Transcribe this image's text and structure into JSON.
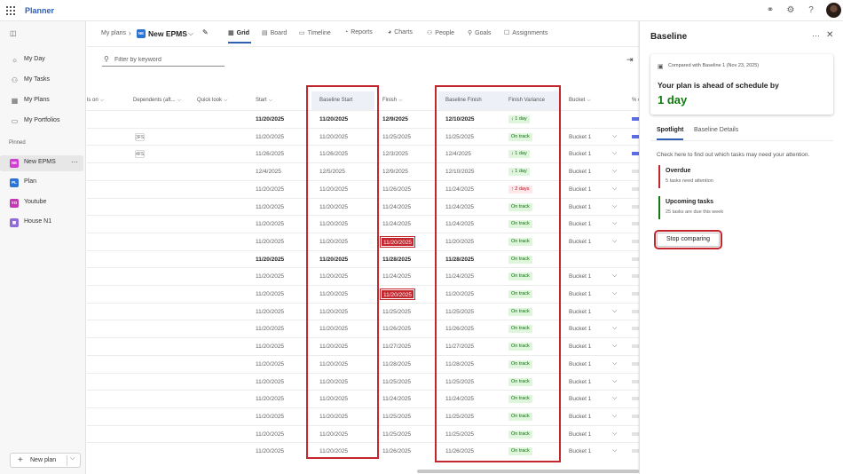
{
  "app": {
    "title": "Planner"
  },
  "topbar": {
    "icons": [
      "waffle-icon",
      "share-icon",
      "settings-icon",
      "help-icon",
      "avatar"
    ]
  },
  "leftnav": {
    "items": [
      {
        "label": "My Day",
        "icon": "sun-icon"
      },
      {
        "label": "My Tasks",
        "icon": "person-icon"
      },
      {
        "label": "My Plans",
        "icon": "grid-icon"
      },
      {
        "label": "My Portfolios",
        "icon": "folder-icon"
      }
    ],
    "pinned_label": "Pinned",
    "pinned": [
      {
        "label": "New EPMS",
        "badge": "NE",
        "color": "#d13dd1"
      },
      {
        "label": "Plan",
        "badge": "PL",
        "color": "#2b73d6"
      },
      {
        "label": "Youtube",
        "badge": "YO",
        "color": "#c239b3"
      },
      {
        "label": "House N1",
        "badge": "▦",
        "color": "#8e6bd6"
      }
    ],
    "new_plan": "New plan"
  },
  "header": {
    "breadcrumb_root": "My plans",
    "plan_badge": "NE",
    "plan_name": "New EPMS",
    "tabs": [
      {
        "label": "Grid",
        "icon": "▦"
      },
      {
        "label": "Board",
        "icon": "▤"
      },
      {
        "label": "Timeline",
        "icon": "▭"
      },
      {
        "label": "Reports",
        "icon": "◔"
      },
      {
        "label": "Charts",
        "icon": "◕"
      },
      {
        "label": "People",
        "icon": "⚇"
      },
      {
        "label": "Goals",
        "icon": "⚲"
      },
      {
        "label": "Assignments",
        "icon": "☐"
      }
    ],
    "filter_placeholder": "Filter by keyword"
  },
  "grid": {
    "columns": {
      "depends_on": "ls on",
      "dependents": "Dependents (aft...",
      "quick_look": "Quick look",
      "start": "Start",
      "baseline_start": "Baseline Start",
      "finish": "Finish",
      "baseline_finish": "Baseline Finish",
      "finish_variance": "Finish Variance",
      "bucket": "Bucket",
      "percent": "% c"
    },
    "rows": [
      {
        "bold": true,
        "dep": "",
        "start": "11/20/2025",
        "bstart": "11/20/2025",
        "finish": "12/9/2025",
        "late": false,
        "bfinish": "12/10/2025",
        "variance": "1 day",
        "vtype": "ahead",
        "bucket": "",
        "progress": "blue"
      },
      {
        "bold": false,
        "dep": "3FS",
        "start": "11/20/2025",
        "bstart": "11/20/2025",
        "finish": "11/25/2025",
        "late": false,
        "bfinish": "11/25/2025",
        "variance": "On track",
        "vtype": "ontrack",
        "bucket": "Bucket 1",
        "progress": "blue"
      },
      {
        "bold": false,
        "dep": "4FS",
        "start": "11/26/2025",
        "bstart": "11/26/2025",
        "finish": "12/3/2025",
        "late": false,
        "bfinish": "12/4/2025",
        "variance": "1 day",
        "vtype": "ahead",
        "bucket": "Bucket 1",
        "progress": "blue"
      },
      {
        "bold": false,
        "dep": "",
        "start": "12/4/2025",
        "bstart": "12/5/2025",
        "finish": "12/9/2025",
        "late": false,
        "bfinish": "12/10/2025",
        "variance": "1 day",
        "vtype": "ahead",
        "bucket": "Bucket 1",
        "progress": "grey"
      },
      {
        "bold": false,
        "dep": "",
        "start": "11/20/2025",
        "bstart": "11/20/2025",
        "finish": "11/26/2025",
        "late": false,
        "bfinish": "11/24/2025",
        "variance": "2 days",
        "vtype": "late",
        "bucket": "Bucket 1",
        "progress": "grey"
      },
      {
        "bold": false,
        "dep": "",
        "start": "11/20/2025",
        "bstart": "11/20/2025",
        "finish": "11/24/2025",
        "late": false,
        "bfinish": "11/24/2025",
        "variance": "On track",
        "vtype": "ontrack",
        "bucket": "Bucket 1",
        "progress": "grey"
      },
      {
        "bold": false,
        "dep": "",
        "start": "11/20/2025",
        "bstart": "11/20/2025",
        "finish": "11/24/2025",
        "late": false,
        "bfinish": "11/24/2025",
        "variance": "On track",
        "vtype": "ontrack",
        "bucket": "Bucket 1",
        "progress": "grey"
      },
      {
        "bold": false,
        "dep": "",
        "start": "11/20/2025",
        "bstart": "11/20/2025",
        "finish": "11/20/2025",
        "late": true,
        "bfinish": "11/20/2025",
        "variance": "On track",
        "vtype": "ontrack",
        "bucket": "Bucket 1",
        "progress": "grey"
      },
      {
        "bold": true,
        "dep": "",
        "start": "11/20/2025",
        "bstart": "11/20/2025",
        "finish": "11/28/2025",
        "late": false,
        "bfinish": "11/28/2025",
        "variance": "On track",
        "vtype": "ontrack",
        "bucket": "",
        "progress": "grey"
      },
      {
        "bold": false,
        "dep": "",
        "start": "11/20/2025",
        "bstart": "11/20/2025",
        "finish": "11/24/2025",
        "late": false,
        "bfinish": "11/24/2025",
        "variance": "On track",
        "vtype": "ontrack",
        "bucket": "Bucket 1",
        "progress": "grey"
      },
      {
        "bold": false,
        "dep": "",
        "start": "11/20/2025",
        "bstart": "11/20/2025",
        "finish": "11/20/2025",
        "late": true,
        "bfinish": "11/20/2025",
        "variance": "On track",
        "vtype": "ontrack",
        "bucket": "Bucket 1",
        "progress": "grey"
      },
      {
        "bold": false,
        "dep": "",
        "start": "11/20/2025",
        "bstart": "11/20/2025",
        "finish": "11/25/2025",
        "late": false,
        "bfinish": "11/25/2025",
        "variance": "On track",
        "vtype": "ontrack",
        "bucket": "Bucket 1",
        "progress": "grey"
      },
      {
        "bold": false,
        "dep": "",
        "start": "11/20/2025",
        "bstart": "11/20/2025",
        "finish": "11/26/2025",
        "late": false,
        "bfinish": "11/26/2025",
        "variance": "On track",
        "vtype": "ontrack",
        "bucket": "Bucket 1",
        "progress": "grey"
      },
      {
        "bold": false,
        "dep": "",
        "start": "11/20/2025",
        "bstart": "11/20/2025",
        "finish": "11/27/2025",
        "late": false,
        "bfinish": "11/27/2025",
        "variance": "On track",
        "vtype": "ontrack",
        "bucket": "Bucket 1",
        "progress": "grey"
      },
      {
        "bold": false,
        "dep": "",
        "start": "11/20/2025",
        "bstart": "11/20/2025",
        "finish": "11/28/2025",
        "late": false,
        "bfinish": "11/28/2025",
        "variance": "On track",
        "vtype": "ontrack",
        "bucket": "Bucket 1",
        "progress": "grey"
      },
      {
        "bold": false,
        "dep": "",
        "start": "11/20/2025",
        "bstart": "11/20/2025",
        "finish": "11/25/2025",
        "late": false,
        "bfinish": "11/25/2025",
        "variance": "On track",
        "vtype": "ontrack",
        "bucket": "Bucket 1",
        "progress": "grey"
      },
      {
        "bold": false,
        "dep": "",
        "start": "11/20/2025",
        "bstart": "11/20/2025",
        "finish": "11/24/2025",
        "late": false,
        "bfinish": "11/24/2025",
        "variance": "On track",
        "vtype": "ontrack",
        "bucket": "Bucket 1",
        "progress": "grey"
      },
      {
        "bold": false,
        "dep": "",
        "start": "11/20/2025",
        "bstart": "11/20/2025",
        "finish": "11/25/2025",
        "late": false,
        "bfinish": "11/25/2025",
        "variance": "On track",
        "vtype": "ontrack",
        "bucket": "Bucket 1",
        "progress": "grey"
      },
      {
        "bold": false,
        "dep": "",
        "start": "11/20/2025",
        "bstart": "11/20/2025",
        "finish": "11/25/2025",
        "late": false,
        "bfinish": "11/25/2025",
        "variance": "On track",
        "vtype": "ontrack",
        "bucket": "Bucket 1",
        "progress": "grey"
      },
      {
        "bold": false,
        "dep": "",
        "start": "11/20/2025",
        "bstart": "11/20/2025",
        "finish": "11/26/2025",
        "late": false,
        "bfinish": "11/26/2025",
        "variance": "On track",
        "vtype": "ontrack",
        "bucket": "Bucket 1",
        "progress": "grey"
      }
    ]
  },
  "panel": {
    "title": "Baseline",
    "compared_with": "Compared with Baseline 1 (Nov 23, 2025)",
    "message": "Your plan is ahead of schedule by",
    "value": "1 day",
    "tabs": [
      "Spotlight",
      "Baseline Details"
    ],
    "hint": "Check here to find out which tasks may need your attention.",
    "spotlight": [
      {
        "title": "Overdue",
        "sub": "5 tasks need attention",
        "color": "#c4262e"
      },
      {
        "title": "Upcoming tasks",
        "sub": "25 tasks are due this week",
        "color": "#107c10"
      }
    ],
    "stop_button": "Stop comparing"
  }
}
